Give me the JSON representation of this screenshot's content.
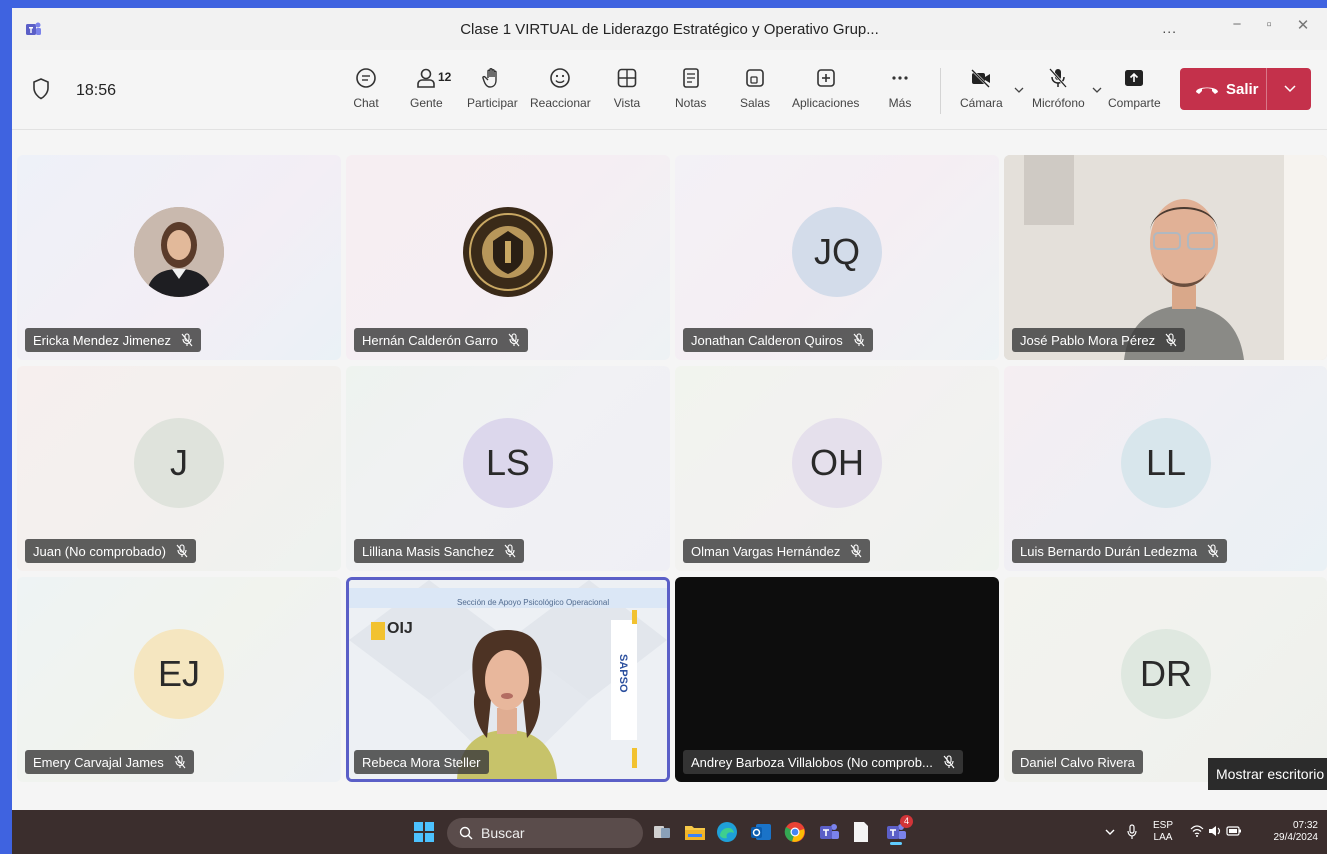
{
  "window": {
    "title": "Clase 1 VIRTUAL de Liderazgo Estratégico y Operativo Grup...",
    "more": "...",
    "minimize": "−",
    "restore": "▫",
    "close": "✕"
  },
  "toolbar": {
    "time": "18:56",
    "people_count": "12",
    "items": {
      "chat": "Chat",
      "people": "Gente",
      "raise": "Participar",
      "react": "Reaccionar",
      "view": "Vista",
      "notes": "Notas",
      "rooms": "Salas",
      "apps": "Aplicaciones",
      "more": "Más",
      "camera": "Cámara",
      "mic": "Micrófono",
      "share": "Comparte"
    },
    "leave": "Salir"
  },
  "participants": [
    {
      "name": "Ericka Mendez Jimenez",
      "initials": ""
    },
    {
      "name": "Hernán Calderón Garro",
      "initials": ""
    },
    {
      "name": "Jonathan Calderon Quiros",
      "initials": "JQ"
    },
    {
      "name": "José Pablo Mora Pérez",
      "initials": ""
    },
    {
      "name": "Juan (No comprobado)",
      "initials": "J"
    },
    {
      "name": "Lilliana Masis Sanchez",
      "initials": "LS"
    },
    {
      "name": "Olman Vargas Hernández",
      "initials": "OH"
    },
    {
      "name": "Luis Bernardo Durán Ledezma",
      "initials": "LL"
    },
    {
      "name": "Emery Carvajal James",
      "initials": "EJ"
    },
    {
      "name": "Rebeca Mora Steller",
      "initials": ""
    },
    {
      "name": "Andrey Barboza Villalobos (No comprob...",
      "initials": ""
    },
    {
      "name": "Daniel Calvo Rivera",
      "initials": "DR"
    }
  ],
  "slide": {
    "header": "Sección de Apoyo Psicológico Operacional",
    "logo": "OIJ",
    "side": "SAPSO"
  },
  "tooltip": "Mostrar escritorio",
  "taskbar": {
    "search": "Buscar",
    "lang1": "ESP",
    "lang2": "LAA",
    "time": "07:32",
    "date": "29/4/2024",
    "teams_badge": "4"
  },
  "colors": {
    "leave": "#c4314b",
    "taskbar": "#3b2e2d",
    "accent": "#5b5fc7"
  }
}
